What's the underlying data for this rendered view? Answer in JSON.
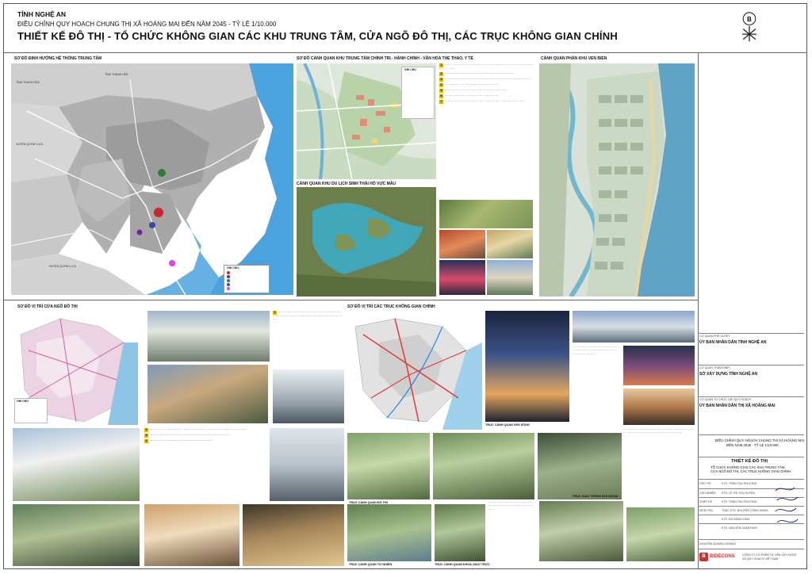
{
  "header": {
    "province": "TỈNH NGHỆ AN",
    "subtitle": "ĐIỀU CHỈNH QUY HOẠCH CHUNG THỊ XÃ HOÀNG MAI ĐẾN NĂM 2045 - TỶ LỆ 1/10.000",
    "title": "THIẾT KẾ ĐÔ THỊ - TỔ CHỨC KHÔNG GIAN CÁC KHU TRUNG TÂM, CỬA NGÕ ĐÔ THỊ, CÁC TRỤC KHÔNG GIAN CHÍNH"
  },
  "panels": {
    "p1": "SƠ ĐỒ ĐỊNH HƯỚNG HỆ THỐNG TRUNG TÂM",
    "p2": "SƠ ĐỒ CẢNH QUAN KHU TRUNG TÂM CHÍNH TRỊ - HÀNH CHÍNH - VĂN HÓA THỂ THAO, Y TẾ",
    "p3": "CẢNH QUAN KHU DU LỊCH SINH THÁI HỒ VỰC MẤU",
    "p4": "CẢNH QUAN PHÂN KHU VEN BIỂN",
    "p5": "SƠ ĐỒ VỊ TRÍ CỬA NGÕ ĐÔ THỊ",
    "p6": "SƠ ĐỒ VỊ TRÍ CÁC TRỤC KHÔNG GIAN CHÍNH"
  },
  "map1": {
    "labels": [
      "TỈNH THANH HÓA",
      "TỈNH THANH HÓA",
      "HUYỆN QUỲNH LƯU",
      "HUYỆN QUỲNH LƯU"
    ],
    "legend_title": "GHI CHÚ:",
    "legend_colors": [
      "#c62828",
      "#7b1fa2",
      "#2e7d32",
      "#3949ab",
      "#e040fb"
    ]
  },
  "map2_legend_title": "GHI CHÚ",
  "map5_legend_title": "GHI CHÚ",
  "photo_captions": {
    "c1": "TRỤC CẢNH QUAN VEN SÔNG",
    "c2": "TRỤC CẢNH QUAN ĐÔ THỊ",
    "c3": "TRỤC CẢNH QUAN KHOA GIÁO TRỰC",
    "c4": "TRỤC GIAO THÔNG ĐỐI NGOẠI",
    "c5": "TRỤC CẢNH QUAN ĐÔ THỊ",
    "c6": "TRỤC CẢNH QUAN TỰ NHIÊN"
  },
  "title_block": {
    "r1_label": "CƠ QUAN PHÊ DUYỆT",
    "r1_value": "ỦY BAN NHÂN DÂN TỈNH NGHỆ AN",
    "r2_label": "CƠ QUAN THẨM ĐỊNH",
    "r2_value": "SỞ XÂY DỰNG TỈNH NGHỆ AN",
    "r3_label": "CƠ QUAN TỔ CHỨC LẬP QUY HOẠCH",
    "r3_value": "ỦY BAN NHÂN DÂN THỊ XÃ HOÀNG MAI",
    "project_lines": [
      "ĐIỀU CHỈNH QUY HOẠCH CHUNG THỊ XÃ HOÀNG MAI",
      "ĐẾN NĂM 2045 - TỶ LỆ 1/10.000"
    ],
    "drawing_title": "THIẾT KẾ ĐÔ THỊ",
    "drawing_sub": [
      "TỔ CHỨC KHÔNG GIAN CÁC KHU TRUNG TÂM,",
      "CỬA NGÕ ĐÔ THỊ, CÁC TRỤC KHÔNG GIAN CHÍNH"
    ],
    "staff": [
      {
        "role": "CHỦ TRÌ",
        "name": "KTS. TRẦN THU PHƯƠNG"
      },
      {
        "role": "CHỦ NHIỆM",
        "name": "KTS. LÊ THỊ THU HUYỀN"
      },
      {
        "role": "THIẾT KẾ",
        "name": "KTS. TRẦN THU PHƯƠNG"
      },
      {
        "role": "KIỂM TRA",
        "name": "THẠC KTS. NGUYỄN CÔNG HÙNG"
      },
      {
        "role": "",
        "name": "KTS. ĐỖ ĐÌNH LONG"
      },
      {
        "role": "",
        "name": "KTS. NGUYỄN XUÂN KHAI"
      }
    ],
    "director": "NGUYỄN QUANG HOÀNG",
    "company_brand": "BIDECONS",
    "company_name": [
      "CÔNG TY CỔ PHẦN TƯ VẤN XÂY DỰNG",
      "VÀ QUY HOẠCH VIỆT NAM"
    ]
  }
}
